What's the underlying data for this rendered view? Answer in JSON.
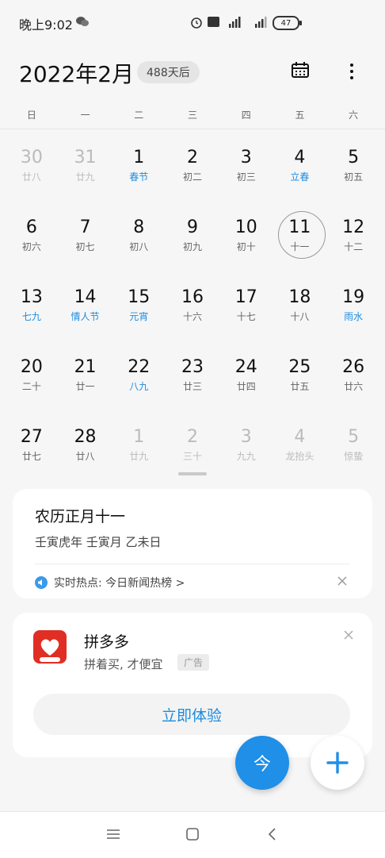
{
  "status": {
    "time": "晚上9:02",
    "battery": "47"
  },
  "header": {
    "title": "2022年2月",
    "days_after": "488天后"
  },
  "weekdays": [
    "日",
    "一",
    "二",
    "三",
    "四",
    "五",
    "六"
  ],
  "weeks": [
    [
      {
        "d": "30",
        "l": "廿八",
        "other": true
      },
      {
        "d": "31",
        "l": "廿九",
        "other": true
      },
      {
        "d": "1",
        "l": "春节",
        "hl": true
      },
      {
        "d": "2",
        "l": "初二"
      },
      {
        "d": "3",
        "l": "初三"
      },
      {
        "d": "4",
        "l": "立春",
        "hl": true
      },
      {
        "d": "5",
        "l": "初五"
      }
    ],
    [
      {
        "d": "6",
        "l": "初六"
      },
      {
        "d": "7",
        "l": "初七"
      },
      {
        "d": "8",
        "l": "初八"
      },
      {
        "d": "9",
        "l": "初九"
      },
      {
        "d": "10",
        "l": "初十"
      },
      {
        "d": "11",
        "l": "十一",
        "today": true
      },
      {
        "d": "12",
        "l": "十二"
      }
    ],
    [
      {
        "d": "13",
        "l": "七九",
        "hl": true
      },
      {
        "d": "14",
        "l": "情人节",
        "hl": true
      },
      {
        "d": "15",
        "l": "元宵",
        "hl": true
      },
      {
        "d": "16",
        "l": "十六"
      },
      {
        "d": "17",
        "l": "十七"
      },
      {
        "d": "18",
        "l": "十八"
      },
      {
        "d": "19",
        "l": "雨水",
        "hl": true
      }
    ],
    [
      {
        "d": "20",
        "l": "二十"
      },
      {
        "d": "21",
        "l": "廿一"
      },
      {
        "d": "22",
        "l": "八九",
        "hl": true
      },
      {
        "d": "23",
        "l": "廿三"
      },
      {
        "d": "24",
        "l": "廿四"
      },
      {
        "d": "25",
        "l": "廿五"
      },
      {
        "d": "26",
        "l": "廿六"
      }
    ],
    [
      {
        "d": "27",
        "l": "廿七"
      },
      {
        "d": "28",
        "l": "廿八"
      },
      {
        "d": "1",
        "l": "廿九",
        "other": true
      },
      {
        "d": "2",
        "l": "三十",
        "other": true
      },
      {
        "d": "3",
        "l": "九九",
        "other": true
      },
      {
        "d": "4",
        "l": "龙抬头",
        "other": true
      },
      {
        "d": "5",
        "l": "惊蛰",
        "other": true
      }
    ]
  ],
  "lunar_card": {
    "title": "农历正月十一",
    "ganzhi": "壬寅虎年 壬寅月 乙未日",
    "hot": "实时热点: 今日新闻热榜 >"
  },
  "ad_card": {
    "app_name": "拼多多",
    "slogan": "拼着买, 才便宜",
    "ad_label": "广告",
    "cta": "立即体验",
    "logo_text": "5周年庆"
  },
  "fab": {
    "today": "今"
  },
  "colors": {
    "accent": "#1f8fe8",
    "festival": "#1e8ce0",
    "brand_red": "#e02e24"
  }
}
